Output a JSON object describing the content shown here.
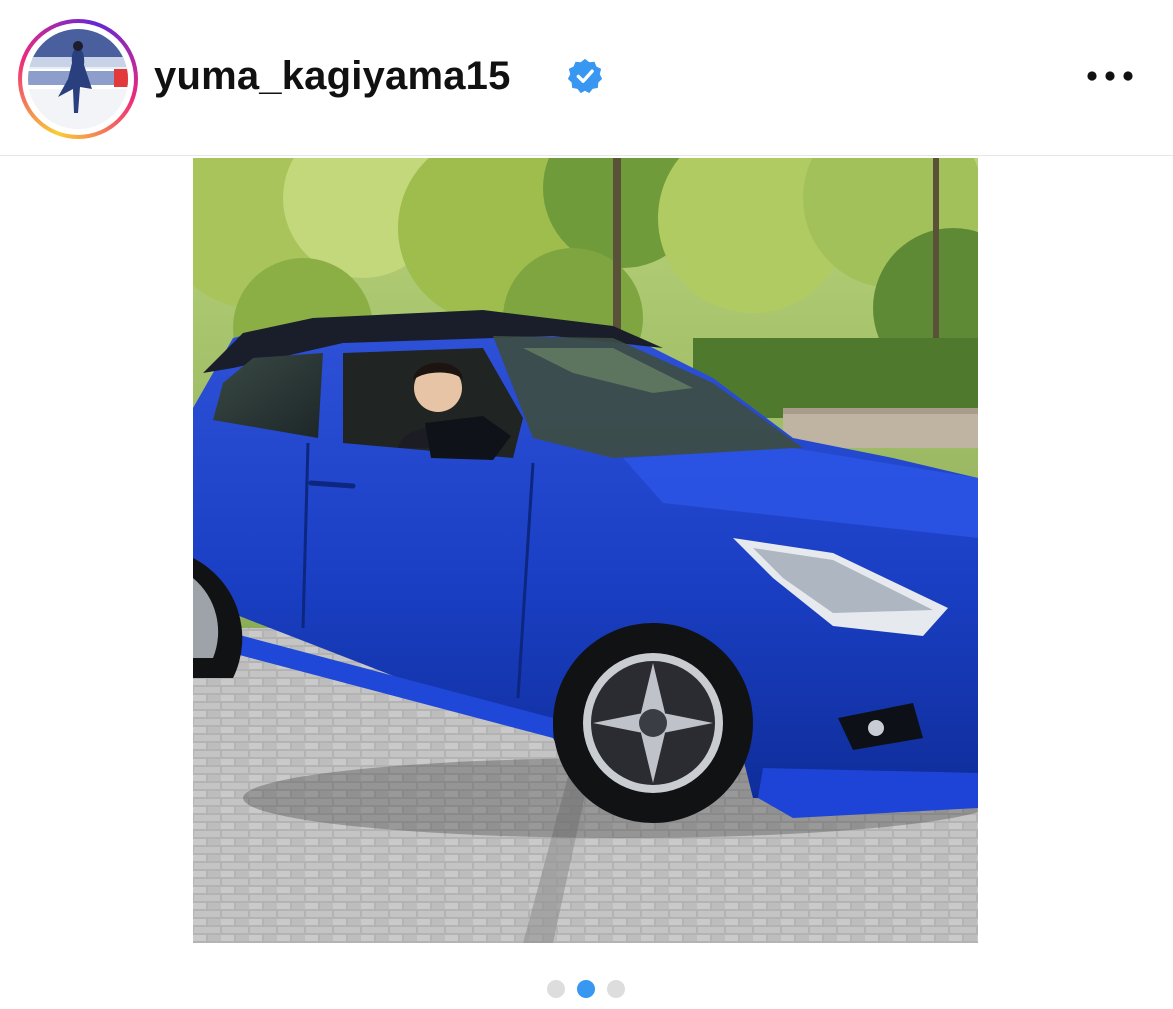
{
  "post": {
    "username": "yuma_kagiyama15",
    "verified": true,
    "verified_icon": "verified-badge-icon",
    "more_icon": "more-options-icon"
  },
  "carousel": {
    "total_slides": 3,
    "active_index": 1
  },
  "colors": {
    "verified_blue": "#3897f0",
    "dot_active": "#3897f0",
    "dot_inactive": "#dddddd",
    "text": "#111111"
  }
}
